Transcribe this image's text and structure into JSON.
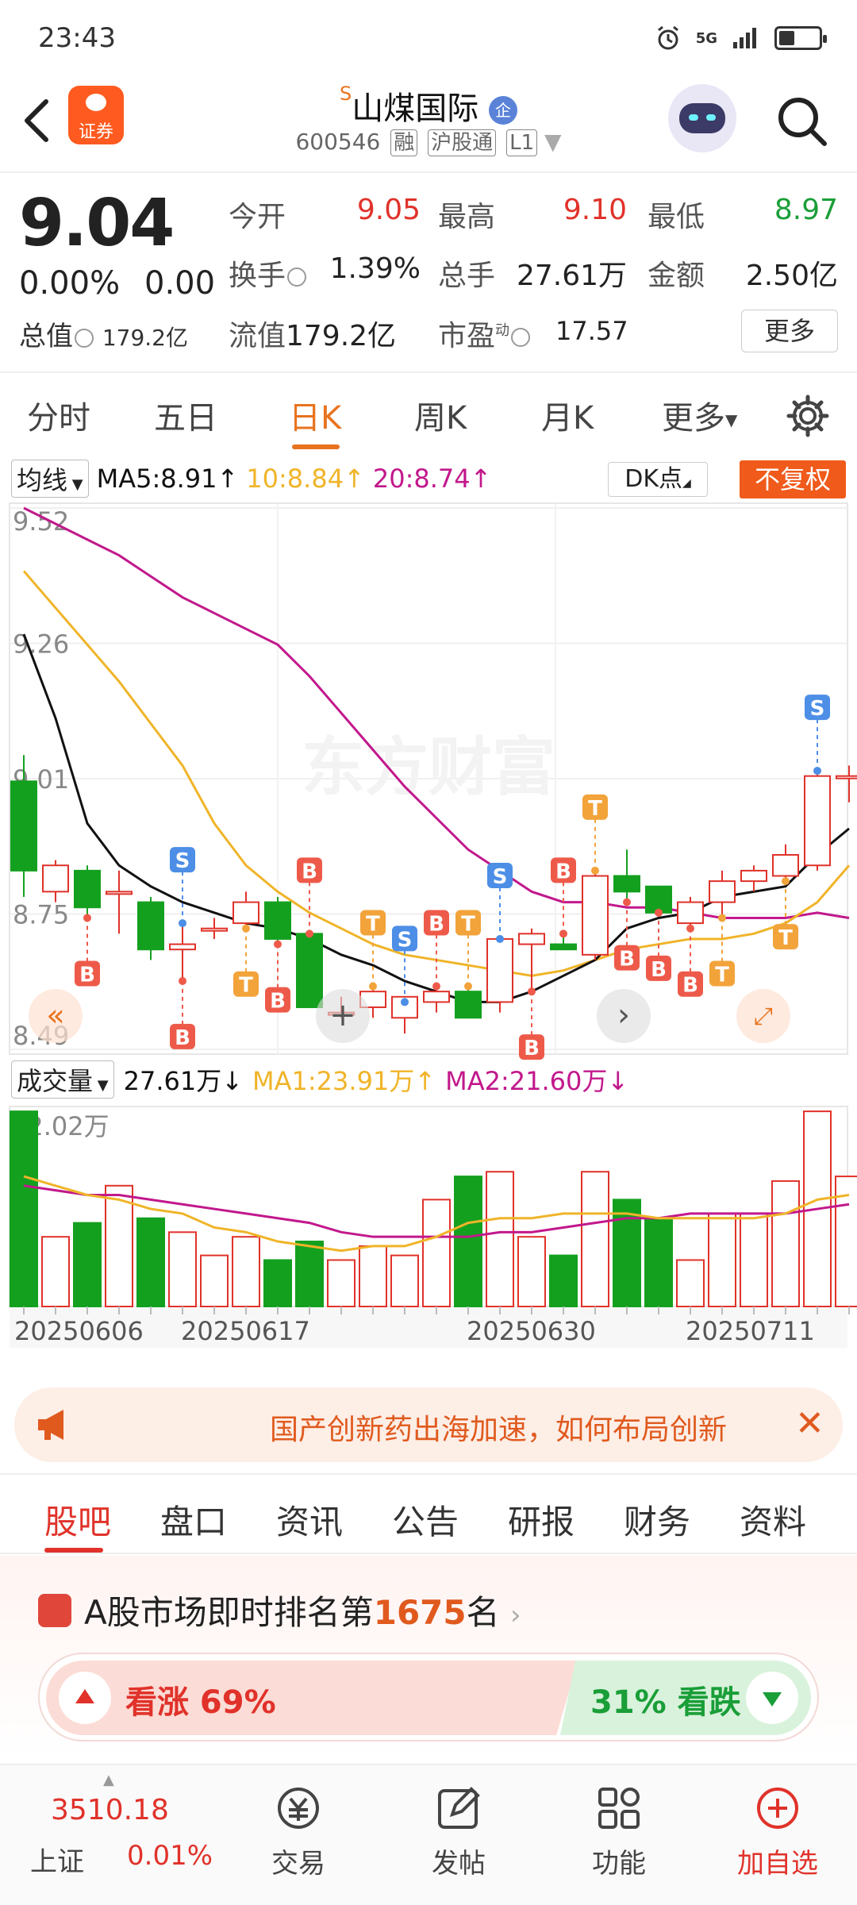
{
  "status": {
    "time": "23:43",
    "network": "5G"
  },
  "header": {
    "app_badge": "证券",
    "stock_name": "山煤国际",
    "s_mark": "S",
    "corp_badge": "企",
    "code": "600546",
    "tags": [
      "融",
      "沪股通",
      "L1"
    ]
  },
  "quote": {
    "price": "9.04",
    "change_pct": "0.00%",
    "change_abs": "0.00",
    "market_cap_label": "总值",
    "market_cap": "179.2亿",
    "fields": [
      {
        "label": "今开",
        "value": "9.05",
        "color": "#e0322a"
      },
      {
        "label": "最高",
        "value": "9.10",
        "color": "#e0322a"
      },
      {
        "label": "最低",
        "value": "8.97",
        "color": "#1a9e38"
      },
      {
        "label": "换手",
        "value": "1.39%",
        "color": "#222222"
      },
      {
        "label": "总手",
        "value": "27.61万",
        "color": "#222222"
      },
      {
        "label": "金额",
        "value": "2.50亿",
        "color": "#222222"
      },
      {
        "label": "流值",
        "value": "179.2亿",
        "color": "#222222"
      },
      {
        "label": "市盈",
        "value": "17.57",
        "color": "#222222"
      }
    ],
    "pe_sup": "动",
    "more_button": "更多"
  },
  "period_tabs": [
    "分时",
    "五日",
    "日K",
    "周K",
    "月K",
    "更多"
  ],
  "active_period": 2,
  "ma_bar": {
    "select": "均线",
    "ma5": "MA5:8.91",
    "ma10": "10:8.84",
    "ma20": "20:8.74",
    "dk": "DK点",
    "fq": "不复权"
  },
  "volume_bar": {
    "select": "成交量",
    "vol": "27.61万",
    "ma1": "MA1:23.91万",
    "ma2": "MA2:21.60万"
  },
  "colors": {
    "up": "#e0322a",
    "down": "#14a01f",
    "accent": "#e8731f",
    "ma5": "#111111",
    "ma10": "#f0b429",
    "ma20": "#c2188c"
  },
  "watermark": "东方财富",
  "chart_data": {
    "type": "candlestick",
    "y_ticks": [
      "9.52",
      "9.26",
      "9.01",
      "8.75",
      "8.49"
    ],
    "ylim": [
      8.49,
      9.52
    ],
    "volume_max_label": "42.02万",
    "volume_max": 42.02,
    "x_labels": [
      "20250606",
      "20250617",
      "20250630",
      "20250711"
    ],
    "candles": [
      {
        "o": 9.0,
        "h": 9.05,
        "l": 8.78,
        "c": 8.83
      },
      {
        "o": 8.79,
        "h": 8.85,
        "l": 8.77,
        "c": 8.84
      },
      {
        "o": 8.83,
        "h": 8.84,
        "l": 8.74,
        "c": 8.76
      },
      {
        "o": 8.79,
        "h": 8.83,
        "l": 8.71,
        "c": 8.79
      },
      {
        "o": 8.77,
        "h": 8.78,
        "l": 8.66,
        "c": 8.68
      },
      {
        "o": 8.68,
        "h": 8.73,
        "l": 8.62,
        "c": 8.69
      },
      {
        "o": 8.72,
        "h": 8.74,
        "l": 8.7,
        "c": 8.72
      },
      {
        "o": 8.73,
        "h": 8.79,
        "l": 8.72,
        "c": 8.77
      },
      {
        "o": 8.77,
        "h": 8.78,
        "l": 8.69,
        "c": 8.7
      },
      {
        "o": 8.71,
        "h": 8.71,
        "l": 8.57,
        "c": 8.57
      },
      {
        "o": 8.56,
        "h": 8.59,
        "l": 8.55,
        "c": 8.56
      },
      {
        "o": 8.57,
        "h": 8.61,
        "l": 8.55,
        "c": 8.6
      },
      {
        "o": 8.55,
        "h": 8.58,
        "l": 8.52,
        "c": 8.59
      },
      {
        "o": 8.58,
        "h": 8.61,
        "l": 8.56,
        "c": 8.6
      },
      {
        "o": 8.6,
        "h": 8.61,
        "l": 8.55,
        "c": 8.55
      },
      {
        "o": 8.58,
        "h": 8.7,
        "l": 8.56,
        "c": 8.7
      },
      {
        "o": 8.69,
        "h": 8.72,
        "l": 8.6,
        "c": 8.71
      },
      {
        "o": 8.69,
        "h": 8.71,
        "l": 8.68,
        "c": 8.68
      },
      {
        "o": 8.67,
        "h": 8.83,
        "l": 8.66,
        "c": 8.82
      },
      {
        "o": 8.82,
        "h": 8.87,
        "l": 8.77,
        "c": 8.79
      },
      {
        "o": 8.8,
        "h": 8.8,
        "l": 8.75,
        "c": 8.75
      },
      {
        "o": 8.73,
        "h": 8.78,
        "l": 8.72,
        "c": 8.77
      },
      {
        "o": 8.77,
        "h": 8.83,
        "l": 8.74,
        "c": 8.81
      },
      {
        "o": 8.81,
        "h": 8.84,
        "l": 8.79,
        "c": 8.83
      },
      {
        "o": 8.82,
        "h": 8.88,
        "l": 8.81,
        "c": 8.86
      },
      {
        "o": 8.84,
        "h": 9.02,
        "l": 8.83,
        "c": 9.01
      },
      {
        "o": 9.01,
        "h": 9.03,
        "l": 8.96,
        "c": 9.01
      }
    ],
    "ma5": [
      9.28,
      9.12,
      8.92,
      8.84,
      8.8,
      8.77,
      8.75,
      8.73,
      8.72,
      8.7,
      8.67,
      8.65,
      8.62,
      8.6,
      8.58,
      8.58,
      8.6,
      8.63,
      8.66,
      8.72,
      8.74,
      8.75,
      8.78,
      8.79,
      8.8,
      8.86,
      8.91
    ],
    "ma10": [
      9.4,
      9.33,
      9.26,
      9.19,
      9.11,
      9.03,
      8.92,
      8.84,
      8.79,
      8.75,
      8.72,
      8.69,
      8.67,
      8.66,
      8.65,
      8.64,
      8.63,
      8.64,
      8.66,
      8.68,
      8.69,
      8.7,
      8.7,
      8.71,
      8.73,
      8.77,
      8.84
    ],
    "ma20": [
      9.52,
      9.49,
      9.46,
      9.43,
      9.39,
      9.35,
      9.32,
      9.29,
      9.26,
      9.2,
      9.13,
      9.06,
      8.99,
      8.93,
      8.87,
      8.83,
      8.79,
      8.77,
      8.77,
      8.76,
      8.76,
      8.75,
      8.74,
      8.74,
      8.74,
      8.75,
      8.74
    ],
    "volume": [
      42,
      15,
      18,
      26,
      19,
      16,
      11,
      15,
      10,
      14,
      10,
      13,
      11,
      23,
      28,
      29,
      15,
      11,
      29,
      23,
      19,
      10,
      20,
      20,
      27,
      42,
      28
    ],
    "vol_ma1": [
      28,
      26,
      24,
      23,
      21,
      20,
      17,
      16,
      14,
      13,
      12,
      13,
      13,
      15,
      18,
      19,
      19,
      20,
      20,
      20,
      19,
      19,
      19,
      19,
      20,
      23,
      24
    ],
    "vol_ma2": [
      26,
      25,
      24,
      24,
      23,
      22,
      21,
      20,
      19,
      18,
      16,
      15,
      15,
      15,
      15,
      16,
      16,
      17,
      18,
      19,
      19,
      20,
      20,
      20,
      20,
      21,
      22
    ],
    "signals": [
      {
        "i": 2,
        "t": "B",
        "pos": "below"
      },
      {
        "i": 5,
        "t": "S",
        "pos": "above"
      },
      {
        "i": 5,
        "t": "B",
        "pos": "below"
      },
      {
        "i": 7,
        "t": "T",
        "pos": "below"
      },
      {
        "i": 8,
        "t": "B",
        "pos": "below"
      },
      {
        "i": 9,
        "t": "B",
        "pos": "above"
      },
      {
        "i": 11,
        "t": "T",
        "pos": "above"
      },
      {
        "i": 12,
        "t": "S",
        "pos": "above"
      },
      {
        "i": 13,
        "t": "B",
        "pos": "above"
      },
      {
        "i": 14,
        "t": "T",
        "pos": "above"
      },
      {
        "i": 15,
        "t": "S",
        "pos": "above"
      },
      {
        "i": 16,
        "t": "B",
        "pos": "below"
      },
      {
        "i": 17,
        "t": "B",
        "pos": "above"
      },
      {
        "i": 18,
        "t": "T",
        "pos": "above"
      },
      {
        "i": 19,
        "t": "B",
        "pos": "below"
      },
      {
        "i": 20,
        "t": "B",
        "pos": "below"
      },
      {
        "i": 21,
        "t": "B",
        "pos": "below"
      },
      {
        "i": 22,
        "t": "T",
        "pos": "below"
      },
      {
        "i": 24,
        "t": "T",
        "pos": "below"
      },
      {
        "i": 25,
        "t": "S",
        "pos": "above"
      }
    ]
  },
  "news": {
    "text": "国产创新药出海加速，如何布局创新"
  },
  "section_tabs": [
    "股吧",
    "盘口",
    "资讯",
    "公告",
    "研报",
    "财务",
    "资料"
  ],
  "rank": {
    "prefix": "A股市场即时排名第",
    "number": "1675",
    "suffix": "名"
  },
  "vote": {
    "up_label": "看涨 69%",
    "down_label": "31% 看跌"
  },
  "bottom_nav": {
    "index_value": "3510.18",
    "index_name": "上证",
    "index_change": "0.01%",
    "items": [
      "交易",
      "发帖",
      "功能",
      "加自选"
    ]
  }
}
